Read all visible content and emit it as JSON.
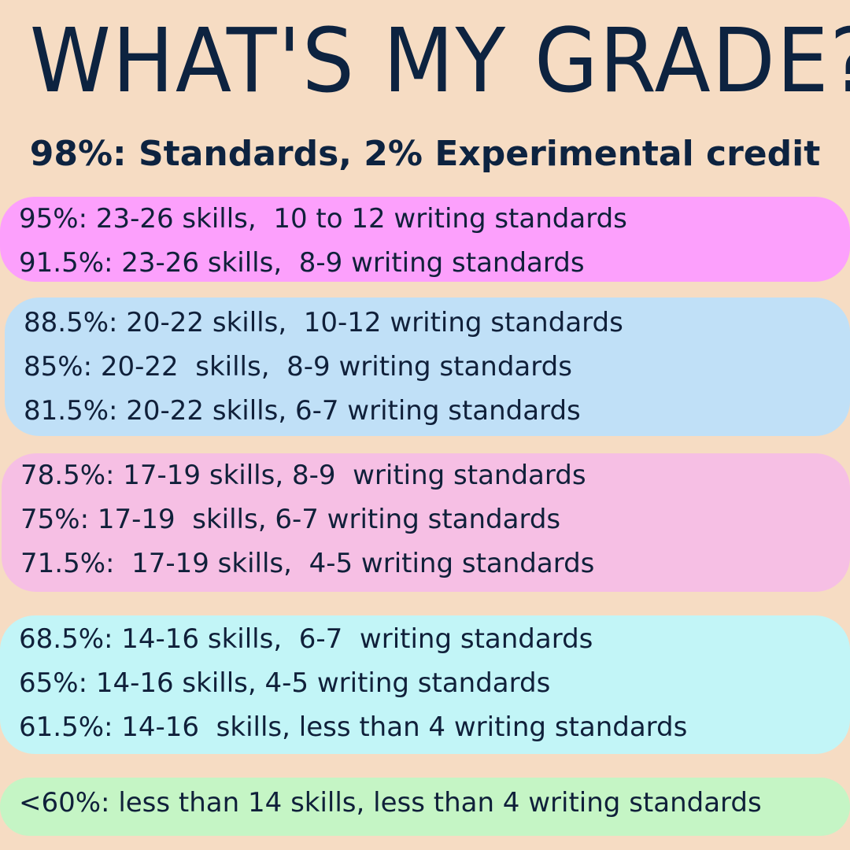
{
  "title": "WHAT'S MY GRADE?",
  "subtitle": "98%: Standards, 2% Experimental credit",
  "bands": [
    {
      "color": "#fca0fc",
      "rows": [
        "95%: 23-26 skills,  10 to 12 writing standards",
        "91.5%: 23-26 skills,  8-9 writing standards"
      ]
    },
    {
      "color": "#c0e0f7",
      "rows": [
        "88.5%: 20-22 skills,  10-12 writing standards",
        "85%: 20-22  skills,  8-9 writing standards",
        "81.5%: 20-22 skills, 6-7 writing standards"
      ]
    },
    {
      "color": "#f6bfe4",
      "rows": [
        "78.5%: 17-19 skills, 8-9  writing standards",
        "75%: 17-19  skills, 6-7 writing standards",
        "71.5%:  17-19 skills,  4-5 writing standards"
      ]
    },
    {
      "color": "#c2f5f7",
      "rows": [
        "68.5%: 14-16 skills,  6-7  writing standards",
        "65%: 14-16 skills, 4-5 writing standards",
        "61.5%: 14-16  skills, less than 4 writing standards"
      ]
    },
    {
      "color": "#c5f5c5",
      "rows": [
        "<60%: less than 14 skills, less than 4 writing standards"
      ]
    }
  ]
}
